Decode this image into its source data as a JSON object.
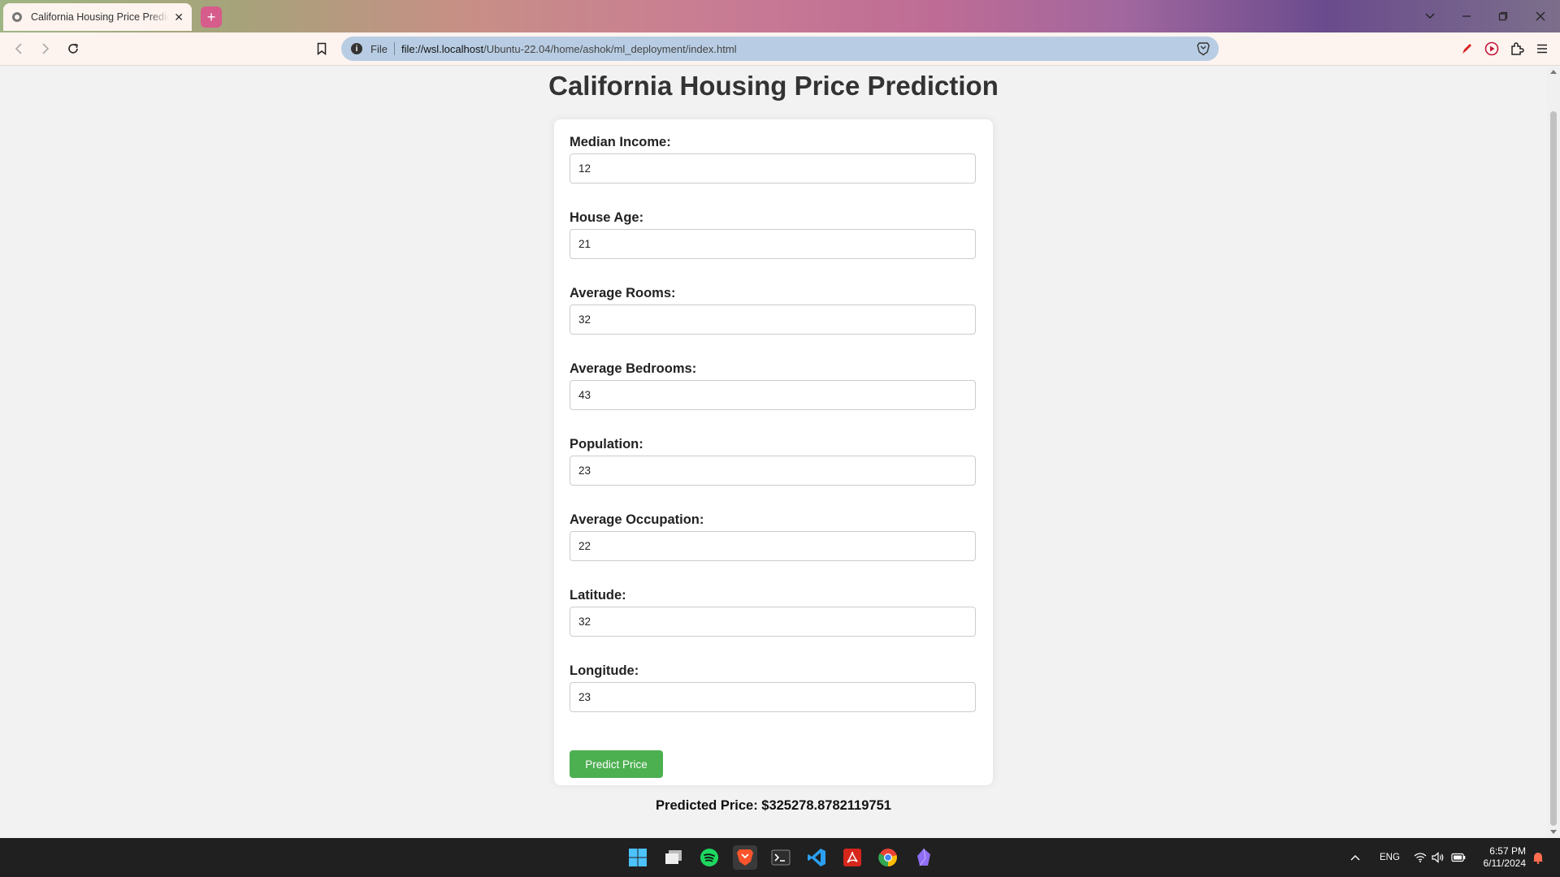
{
  "browser": {
    "tab_title": "California Housing Price Prediction",
    "new_tab_label": "+",
    "close_tab_label": "✕",
    "url_scheme": "File",
    "url_host": "file://wsl.localhost",
    "url_path": "/Ubuntu-22.04/home/ashok/ml_deployment/index.html",
    "icons": [
      "back-icon",
      "forward-icon",
      "reload-icon",
      "bookmark-icon",
      "info-icon",
      "brave-shields-icon",
      "pen-icon",
      "media-icon",
      "extensions-icon",
      "menu-icon",
      "tab-search-icon",
      "minimize-icon",
      "restore-icon",
      "close-window-icon"
    ]
  },
  "page": {
    "title": "California Housing Price Prediction",
    "fields": [
      {
        "label": "Median Income:",
        "value": "12"
      },
      {
        "label": "House Age:",
        "value": "21"
      },
      {
        "label": "Average Rooms:",
        "value": "32"
      },
      {
        "label": "Average Bedrooms:",
        "value": "43"
      },
      {
        "label": "Population:",
        "value": "23"
      },
      {
        "label": "Average Occupation:",
        "value": "22"
      },
      {
        "label": "Latitude:",
        "value": "32"
      },
      {
        "label": "Longitude:",
        "value": "23"
      }
    ],
    "button_label": "Predict Price",
    "result_text": "Predicted Price: $325278.8782119751"
  },
  "taskbar": {
    "apps": [
      "windows-start-icon",
      "task-view-icon",
      "spotify-icon",
      "brave-icon",
      "terminal-icon",
      "vscode-icon",
      "acrobat-icon",
      "chrome-icon",
      "obsidian-icon"
    ],
    "language": "ENG",
    "time": "6:57 PM",
    "date": "6/11/2024"
  },
  "colors": {
    "button": "#4caf50",
    "tab_bg": "#fdf3ef",
    "omnibox": "#b8cde3",
    "taskbar": "#202020"
  }
}
